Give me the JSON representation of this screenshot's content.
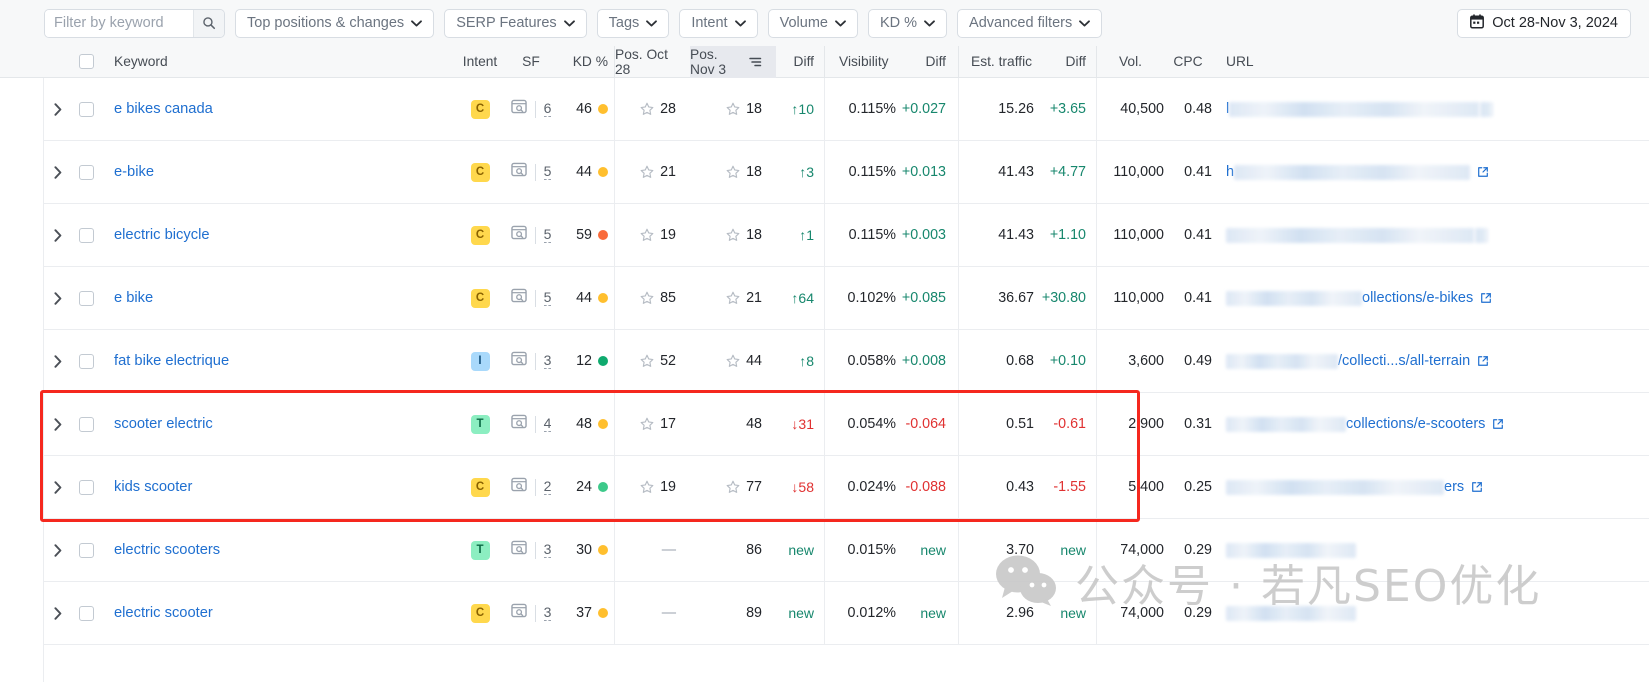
{
  "toolbar": {
    "search_placeholder": "Filter by keyword",
    "search_value": "",
    "search_icon": "search-icon",
    "filters": [
      {
        "label": "Top positions & changes"
      },
      {
        "label": "SERP Features"
      },
      {
        "label": "Tags"
      },
      {
        "label": "Intent"
      },
      {
        "label": "Volume"
      },
      {
        "label": "KD %"
      },
      {
        "label": "Advanced filters"
      }
    ],
    "date_range": "Oct 28-Nov 3, 2024",
    "calendar_icon": "calendar-icon"
  },
  "table": {
    "columns": {
      "keyword": "Keyword",
      "intent": "Intent",
      "sf": "SF",
      "kd": "KD %",
      "pos_a": "Pos. Oct 28",
      "pos_b": "Pos. Nov 3",
      "diff1": "Diff",
      "visibility": "Visibility",
      "diff2": "Diff",
      "traffic": "Est. traffic",
      "diff3": "Diff",
      "vol": "Vol.",
      "cpc": "CPC",
      "url": "URL"
    },
    "rows": [
      {
        "keyword": "e bikes canada",
        "intent": "C",
        "sf": "6",
        "kd": "46",
        "kd_color": "#ffbf2e",
        "pos_a": "28",
        "pos_a_star": true,
        "pos_b": "18",
        "pos_b_star": true,
        "diff1": "↑10",
        "diff1_dir": "up",
        "visibility": "0.115%",
        "diff2": "+0.027",
        "diff2_dir": "up",
        "traffic": "15.26",
        "diff3": "+3.65",
        "diff3_dir": "up",
        "vol": "40,500",
        "cpc": "0.48",
        "url_prefix": "l",
        "url_blur": 250,
        "url_text": "",
        "url_tail_blur": 14,
        "url_ext": false
      },
      {
        "keyword": "e-bike",
        "intent": "C",
        "sf": "5",
        "kd": "44",
        "kd_color": "#ffbf2e",
        "pos_a": "21",
        "pos_a_star": true,
        "pos_b": "18",
        "pos_b_star": true,
        "diff1": "↑3",
        "diff1_dir": "up",
        "visibility": "0.115%",
        "diff2": "+0.013",
        "diff2_dir": "up",
        "traffic": "41.43",
        "diff3": "+4.77",
        "diff3_dir": "up",
        "vol": "110,000",
        "cpc": "0.41",
        "url_prefix": "h",
        "url_blur": 236,
        "url_text": "",
        "url_tail_blur": 0,
        "url_ext": true
      },
      {
        "keyword": "electric bicycle",
        "intent": "C",
        "sf": "5",
        "kd": "59",
        "kd_color": "#f96a3a",
        "pos_a": "19",
        "pos_a_star": true,
        "pos_b": "18",
        "pos_b_star": true,
        "diff1": "↑1",
        "diff1_dir": "up",
        "visibility": "0.115%",
        "diff2": "+0.003",
        "diff2_dir": "up",
        "traffic": "41.43",
        "diff3": "+1.10",
        "diff3_dir": "up",
        "vol": "110,000",
        "cpc": "0.41",
        "url_prefix": "",
        "url_blur": 248,
        "url_text": "",
        "url_tail_blur": 14,
        "url_ext": false
      },
      {
        "keyword": "e bike",
        "intent": "C",
        "sf": "5",
        "kd": "44",
        "kd_color": "#ffbf2e",
        "pos_a": "85",
        "pos_a_star": true,
        "pos_b": "21",
        "pos_b_star": true,
        "diff1": "↑64",
        "diff1_dir": "up",
        "visibility": "0.102%",
        "diff2": "+0.085",
        "diff2_dir": "up",
        "traffic": "36.67",
        "diff3": "+30.80",
        "diff3_dir": "up",
        "vol": "110,000",
        "cpc": "0.41",
        "url_prefix": "",
        "url_blur": 136,
        "url_text": "ollections/e-bikes",
        "url_tail_blur": 0,
        "url_ext": true
      },
      {
        "keyword": "fat bike electrique",
        "intent": "I",
        "sf": "3",
        "kd": "12",
        "kd_color": "#0faa6e",
        "pos_a": "52",
        "pos_a_star": true,
        "pos_b": "44",
        "pos_b_star": true,
        "diff1": "↑8",
        "diff1_dir": "up",
        "visibility": "0.058%",
        "diff2": "+0.008",
        "diff2_dir": "up",
        "traffic": "0.68",
        "diff3": "+0.10",
        "diff3_dir": "up",
        "vol": "3,600",
        "cpc": "0.49",
        "url_prefix": "",
        "url_blur": 112,
        "url_text": "/collecti...s/all-terrain",
        "url_tail_blur": 0,
        "url_ext": true
      },
      {
        "keyword": "scooter electric",
        "intent": "T",
        "sf": "4",
        "kd": "48",
        "kd_color": "#ffbf2e",
        "pos_a": "17",
        "pos_a_star": true,
        "pos_b": "48",
        "pos_b_star": false,
        "diff1": "↓31",
        "diff1_dir": "down",
        "visibility": "0.054%",
        "diff2": "-0.064",
        "diff2_dir": "down",
        "traffic": "0.51",
        "diff3": "-0.61",
        "diff3_dir": "down",
        "vol": "2,900",
        "cpc": "0.31",
        "url_prefix": "",
        "url_blur": 120,
        "url_text": "collections/e-scooters",
        "url_tail_blur": 0,
        "url_ext": true
      },
      {
        "keyword": "kids scooter",
        "intent": "C",
        "sf": "2",
        "kd": "24",
        "kd_color": "#3dc98a",
        "pos_a": "19",
        "pos_a_star": true,
        "pos_b": "77",
        "pos_b_star": true,
        "diff1": "↓58",
        "diff1_dir": "down",
        "visibility": "0.024%",
        "diff2": "-0.088",
        "diff2_dir": "down",
        "traffic": "0.43",
        "diff3": "-1.55",
        "diff3_dir": "down",
        "vol": "5,400",
        "cpc": "0.25",
        "url_prefix": "",
        "url_blur": 218,
        "url_text": "ers",
        "url_tail_blur": 0,
        "url_ext": true
      },
      {
        "keyword": "electric scooters",
        "intent": "T",
        "sf": "3",
        "kd": "30",
        "kd_color": "#ffbf2e",
        "pos_a": "—",
        "pos_a_star": false,
        "pos_b": "86",
        "pos_b_star": false,
        "diff1": "new",
        "diff1_dir": "new",
        "visibility": "0.015%",
        "diff2": "new",
        "diff2_dir": "new",
        "traffic": "3.70",
        "diff3": "new",
        "diff3_dir": "new",
        "vol": "74,000",
        "cpc": "0.29",
        "url_prefix": "",
        "url_blur": 130,
        "url_text": "",
        "url_tail_blur": 0,
        "url_ext": false
      },
      {
        "keyword": "electric scooter",
        "intent": "C",
        "sf": "3",
        "kd": "37",
        "kd_color": "#ffbf2e",
        "pos_a": "—",
        "pos_a_star": false,
        "pos_b": "89",
        "pos_b_star": false,
        "diff1": "new",
        "diff1_dir": "new",
        "visibility": "0.012%",
        "diff2": "new",
        "diff2_dir": "new",
        "traffic": "2.96",
        "diff3": "new",
        "diff3_dir": "new",
        "vol": "74,000",
        "cpc": "0.29",
        "url_prefix": "",
        "url_blur": 130,
        "url_text": "",
        "url_tail_blur": 0,
        "url_ext": false
      }
    ]
  },
  "annotation": {
    "highlight_color": "#f5281e",
    "highlighted_keywords": [
      "scooter electric",
      "kids scooter"
    ]
  },
  "watermark": {
    "text": "公众号 · 若凡SEO优化",
    "icon": "wechat-icon"
  },
  "colors": {
    "link": "#1f6fd0",
    "positive": "#17876d",
    "negative": "#e03131",
    "header_bg": "#f7f8f9",
    "sorted_col_bg": "#e7e9ee"
  }
}
